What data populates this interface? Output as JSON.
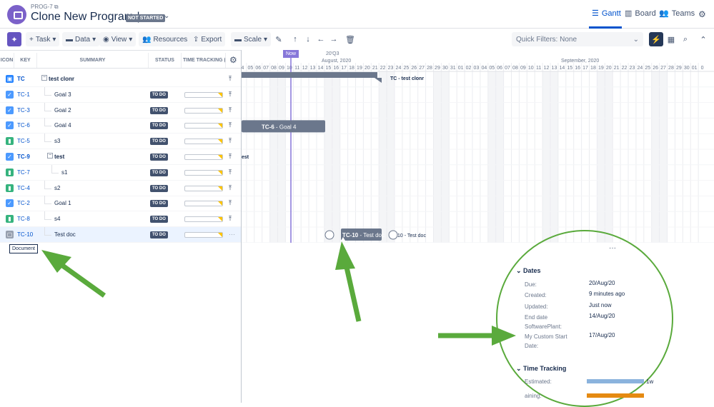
{
  "header": {
    "program_key": "PROG-7",
    "program_title": "Clone New Program |",
    "status": "NOT STARTED",
    "tabs": [
      {
        "label": "Gantt",
        "icon": "gantt-icon"
      },
      {
        "label": "Board",
        "icon": "board-icon"
      },
      {
        "label": "Teams",
        "icon": "teams-icon"
      }
    ]
  },
  "toolbar": {
    "task_label": "Task",
    "data_label": "Data",
    "view_label": "View",
    "resources_label": "Resources",
    "export_label": "Export",
    "scale_label": "Scale",
    "quick_filters": "Quick Filters: None"
  },
  "columns": {
    "icon": "ICON",
    "key": "KEY",
    "summary": "SUMMARY",
    "status": "STATUS",
    "time_tracking": "TIME TRACKING (E"
  },
  "rows": [
    {
      "key": "TC",
      "summary": "test clonr",
      "status": "",
      "type": "epic",
      "bold": true,
      "expander": "−"
    },
    {
      "key": "TC-1",
      "summary": "Goal 3",
      "status": "TO DO",
      "type": "task"
    },
    {
      "key": "TC-3",
      "summary": "Goal 2",
      "status": "TO DO",
      "type": "task"
    },
    {
      "key": "TC-6",
      "summary": "Goal 4",
      "status": "TO DO",
      "type": "task"
    },
    {
      "key": "TC-5",
      "summary": "s3",
      "status": "TO DO",
      "type": "story"
    },
    {
      "key": "TC-9",
      "summary": "test",
      "status": "TO DO",
      "type": "task",
      "bold": true,
      "expander": "−"
    },
    {
      "key": "TC-7",
      "summary": "s1",
      "status": "TO DO",
      "type": "story"
    },
    {
      "key": "TC-4",
      "summary": "s2",
      "status": "TO DO",
      "type": "story"
    },
    {
      "key": "TC-2",
      "summary": "Goal 1",
      "status": "TO DO",
      "type": "task"
    },
    {
      "key": "TC-8",
      "summary": "s4",
      "status": "TO DO",
      "type": "story"
    },
    {
      "key": "TC-10",
      "summary": "Test doc",
      "status": "TO DO",
      "type": "doc"
    }
  ],
  "tooltip": "Document",
  "timeline": {
    "quarter": "20'Q3",
    "now_label": "Now",
    "month1": "August, 2020",
    "month2": "September, 2020",
    "days": [
      "4",
      "05",
      "06",
      "07",
      "08",
      "09",
      "10",
      "11",
      "12",
      "13",
      "14",
      "15",
      "16",
      "17",
      "18",
      "19",
      "20",
      "21",
      "22",
      "23",
      "24",
      "25",
      "26",
      "27",
      "28",
      "29",
      "30",
      "31",
      "01",
      "02",
      "03",
      "04",
      "05",
      "06",
      "07",
      "08",
      "09",
      "10",
      "11",
      "12",
      "13",
      "14",
      "15",
      "16",
      "17",
      "18",
      "19",
      "20",
      "21",
      "22",
      "23",
      "24",
      "25",
      "26",
      "27",
      "28",
      "29",
      "30",
      "01",
      "0"
    ],
    "bar_tc_label": "TC - test clonr",
    "bar_tc6_key": "TC-6",
    "bar_tc6_text": " - Goal 4",
    "bar_tc9_label": "est",
    "bar_tc10_key": "TC-10",
    "bar_tc10_text": " - Test doc",
    "bar_tc10_after": "10 - Test doc"
  },
  "panel": {
    "more": "···",
    "dates_title": "Dates",
    "fields": [
      {
        "label": "Due:",
        "value": "20/Aug/20"
      },
      {
        "label": "Created:",
        "value": "9 minutes ago"
      },
      {
        "label": "Updated:",
        "value": "Just now"
      },
      {
        "label": "End date",
        "label2": "SoftwarePlant:",
        "value": "14/Aug/20"
      },
      {
        "label": "My Custom Start",
        "label2": "Date:",
        "value": "17/Aug/20"
      }
    ],
    "time_title": "Time Tracking",
    "estimated_label": "Estimated:",
    "estimated_value": "1w",
    "remaining_label": "aining:"
  },
  "colors": {
    "accent": "#0052cc",
    "annotation": "#5aaa3c",
    "bar": "#6b778c",
    "now": "#8777d9"
  }
}
